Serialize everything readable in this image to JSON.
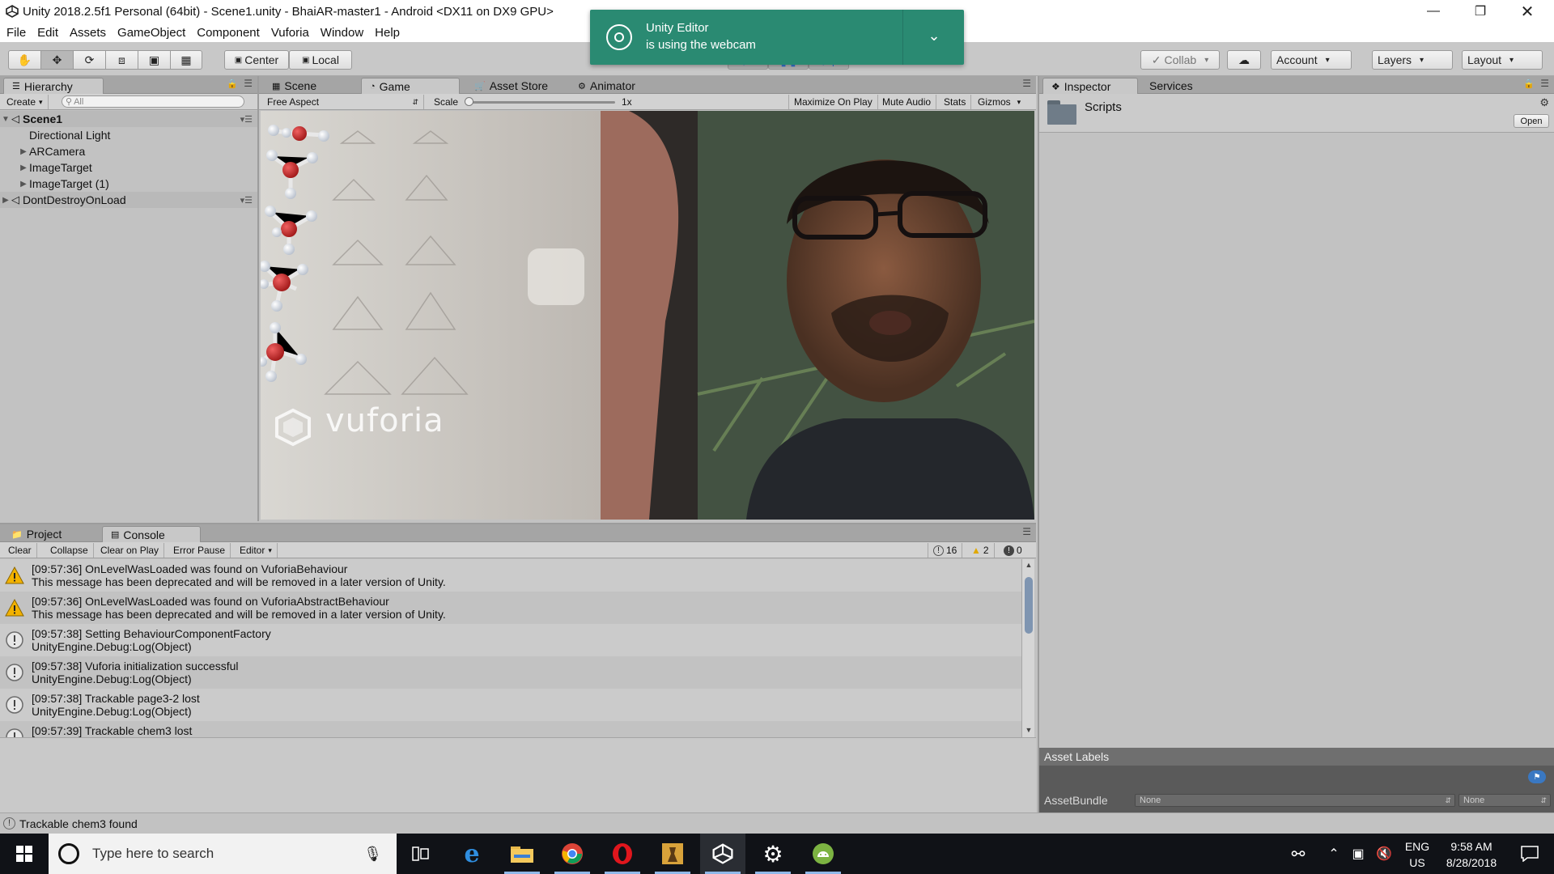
{
  "window": {
    "title": "Unity 2018.2.5f1 Personal (64bit) - Scene1.unity - BhaiAR-master1 - Android <DX11 on DX9 GPU>",
    "controls": [
      "minimize",
      "restore",
      "close"
    ]
  },
  "menu": [
    "File",
    "Edit",
    "Assets",
    "GameObject",
    "Component",
    "Vuforia",
    "Window",
    "Help"
  ],
  "toolbar": {
    "tools": [
      "hand-icon",
      "move-icon",
      "rotate-icon",
      "scale-icon",
      "rect-icon",
      "transform-icon"
    ],
    "pivot": "Center",
    "space": "Local",
    "collab": "Collab",
    "account": "Account",
    "layers": "Layers",
    "layout": "Layout"
  },
  "notification": {
    "title": "Unity Editor",
    "message": "is using the webcam"
  },
  "hierarchy": {
    "tab": "Hierarchy",
    "create": "Create",
    "search_placeholder": "All",
    "items": [
      {
        "label": "Scene1",
        "level": 0,
        "expanded": true
      },
      {
        "label": "Directional Light",
        "level": 1
      },
      {
        "label": "ARCamera",
        "level": 1,
        "collapsed": true
      },
      {
        "label": "ImageTarget",
        "level": 1,
        "collapsed": true
      },
      {
        "label": "ImageTarget (1)",
        "level": 1,
        "collapsed": true
      },
      {
        "label": "DontDestroyOnLoad",
        "level": 0,
        "collapsed": true
      }
    ]
  },
  "center_tabs": [
    "Scene",
    "Game",
    "Asset Store",
    "Animator"
  ],
  "game_bar": {
    "aspect": "Free Aspect",
    "scale_label": "Scale",
    "scale_value": "1x",
    "buttons": [
      "Maximize On Play",
      "Mute Audio",
      "Stats",
      "Gizmos"
    ]
  },
  "game_view": {
    "watermark": "vuforia"
  },
  "bottom_tabs": [
    "Project",
    "Console"
  ],
  "console": {
    "buttons": [
      "Clear",
      "Collapse",
      "Clear on Play",
      "Error Pause",
      "Editor"
    ],
    "counts": {
      "logs": "16",
      "warnings": "2",
      "errors": "0"
    },
    "entries": [
      {
        "type": "warning",
        "line1": "[09:57:36] OnLevelWasLoaded was found on VuforiaBehaviour",
        "line2": "This message has been deprecated and will be removed in a later version of Unity."
      },
      {
        "type": "warning",
        "line1": "[09:57:36] OnLevelWasLoaded was found on VuforiaAbstractBehaviour",
        "line2": "This message has been deprecated and will be removed in a later version of Unity."
      },
      {
        "type": "info",
        "line1": "[09:57:38] Setting BehaviourComponentFactory",
        "line2": "UnityEngine.Debug:Log(Object)"
      },
      {
        "type": "info",
        "line1": "[09:57:38] Vuforia initialization successful",
        "line2": "UnityEngine.Debug:Log(Object)"
      },
      {
        "type": "info",
        "line1": "[09:57:38] Trackable page3-2 lost",
        "line2": "UnityEngine.Debug:Log(Object)"
      },
      {
        "type": "info",
        "line1": "[09:57:39] Trackable chem3 lost",
        "line2": ""
      }
    ]
  },
  "status_bar": "Trackable chem3 found",
  "inspector": {
    "tabs": [
      "Inspector",
      "Services"
    ],
    "asset_name": "Scripts",
    "open_button": "Open",
    "asset_labels": "Asset Labels",
    "asset_bundle_label": "AssetBundle",
    "bundle_value_1": "None",
    "bundle_value_2": "None"
  },
  "taskbar": {
    "search_placeholder": "Type here to search",
    "apps": [
      "task-view-icon",
      "edge-icon",
      "file-explorer-icon",
      "chrome-icon",
      "opera-icon",
      "game-icon",
      "unity-icon",
      "settings-icon",
      "android-studio-icon"
    ],
    "language_1": "ENG",
    "language_2": "US",
    "time": "9:58 AM",
    "date": "8/28/2018"
  },
  "colors": {
    "notification_bg": "#2a8a72",
    "panel_bg": "#c2c2c2",
    "taskbar_bg": "#101217",
    "warning": "#f2b200"
  }
}
